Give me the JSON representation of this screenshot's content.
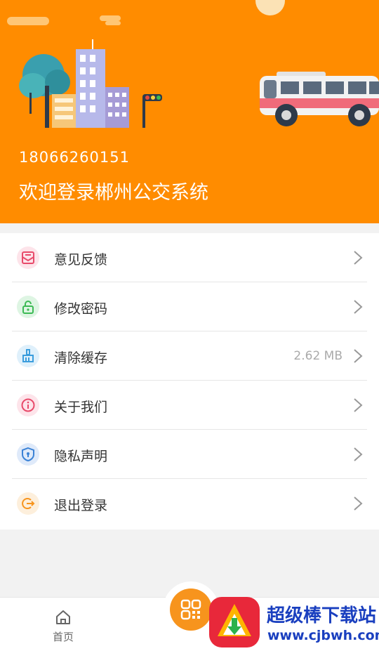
{
  "header": {
    "phone": "18066260151",
    "welcome": "欢迎登录郴州公交系统",
    "bg_color": "#ff8c00"
  },
  "menu": {
    "items": [
      {
        "label": "意见反馈",
        "icon": "feedback-mail-icon",
        "icon_color": "#e84a6a",
        "value": ""
      },
      {
        "label": "修改密码",
        "icon": "unlock-icon",
        "icon_color": "#3cba54",
        "value": ""
      },
      {
        "label": "清除缓存",
        "icon": "broom-icon",
        "icon_color": "#3b9ddd",
        "value": "2.62 MB"
      },
      {
        "label": "关于我们",
        "icon": "info-icon",
        "icon_color": "#e84a6a",
        "value": ""
      },
      {
        "label": "隐私声明",
        "icon": "shield-lock-icon",
        "icon_color": "#3b82d6",
        "value": ""
      },
      {
        "label": "退出登录",
        "icon": "logout-icon",
        "icon_color": "#f7941d",
        "value": ""
      }
    ]
  },
  "tabbar": {
    "home_label": "首页",
    "center_icon": "qr-scan-icon",
    "accent": "#f7941d"
  },
  "watermark": {
    "title": "超级棒下载站",
    "url": "www.cjbwh.com"
  }
}
